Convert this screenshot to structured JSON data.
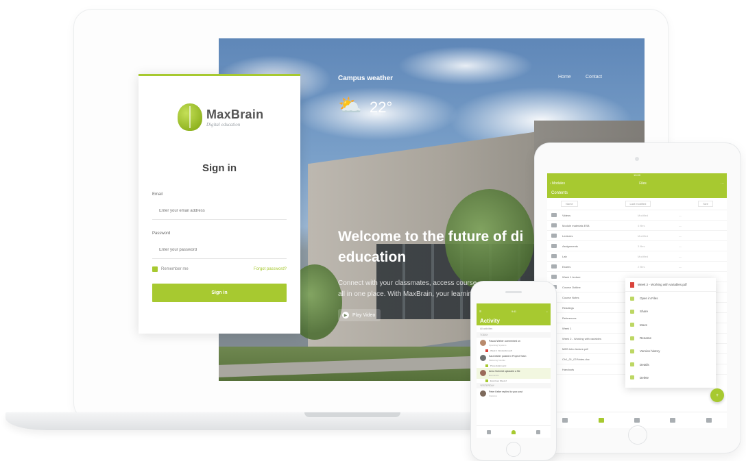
{
  "colors": {
    "accent": "#a7c930",
    "dark_text": "#444444",
    "danger_file": "#d9433b"
  },
  "campus_site": {
    "weather_label": "Campus weather",
    "weather_icon": "partly-cloudy-icon",
    "temperature": "22°",
    "top_links": [
      "Home",
      "Contact"
    ],
    "headline_line1": "Welcome to the future of di",
    "headline_line2": "education",
    "body_line1": "Connect with your classmates, access course",
    "body_line2": "all in one place. With MaxBrain, your learnin",
    "play_label": "Play Video"
  },
  "signin": {
    "brand_name": "MaxBrain",
    "brand_tagline": "Digital education",
    "title": "Sign in",
    "email_label": "Email",
    "email_placeholder": "Enter your email address",
    "password_label": "Password",
    "password_placeholder": "Enter your password",
    "remember_label": "Remember me",
    "forgot_label": "Forgot password?",
    "submit_label": "Sign in"
  },
  "tablet_app": {
    "status": "10:00",
    "back_label": "‹ Modules",
    "nav_title": "Files",
    "section_title": "Contents",
    "toolbar": {
      "sort": "Name",
      "filter": "Last modified",
      "size": "Size"
    },
    "files": [
      {
        "name": "Videos",
        "meta": "Modified",
        "size": "—"
      },
      {
        "name": "Module materials ESB",
        "meta": "4 files",
        "size": "—"
      },
      {
        "name": "Lectures",
        "meta": "Modified",
        "size": "—"
      },
      {
        "name": "Assignments",
        "meta": "3 files",
        "size": "—"
      },
      {
        "name": "Lab",
        "meta": "Modified",
        "size": "—"
      },
      {
        "name": "Exams",
        "meta": "2 files",
        "size": "—"
      },
      {
        "name": "Week 1 lecture",
        "meta": "",
        "size": ""
      },
      {
        "name": "Course Outline",
        "meta": "",
        "size": ""
      },
      {
        "name": "Course Notes",
        "meta": "",
        "size": ""
      },
      {
        "name": "Readings",
        "meta": "",
        "size": ""
      },
      {
        "name": "References",
        "meta": "",
        "size": ""
      },
      {
        "name": "Week 1",
        "meta": "",
        "size": ""
      },
      {
        "name": "Week 2 - Working with variables",
        "meta": "",
        "size": ""
      },
      {
        "name": "MBS.Intro lecture.pdf",
        "meta": "",
        "size": ""
      },
      {
        "name": "Ch1_01_03 Notes.doc",
        "meta": "",
        "size": ""
      },
      {
        "name": "Handouts",
        "meta": "",
        "size": ""
      }
    ],
    "popup": {
      "file_name": "Week 2 - Working with variables.pdf",
      "items": [
        "Open in Files",
        "Share",
        "Move",
        "Rename",
        "Version history",
        "Details",
        "Delete"
      ]
    },
    "fab_label": "+"
  },
  "phone_app": {
    "time": "9:41",
    "title": "Activity",
    "subtitle": "All activities",
    "section_today": "TODAY",
    "section_yesterday": "YESTERDAY",
    "entries": [
      {
        "name": "Pascal Weber commented on",
        "detail": "Operating Systems",
        "attachment": "Week 1 Introduction.pdf"
      },
      {
        "name": "Sara Müller posted in Project Team",
        "detail": "Marketing Module",
        "attachment": "Presentation.pptx"
      },
      {
        "name": "Anna Schmidt uploaded a file",
        "detail": "Economics",
        "attachment": "Exercises Week 2"
      },
      {
        "name": "Peter Keller replied to your post",
        "detail": "Statistics",
        "attachment": ""
      }
    ]
  }
}
